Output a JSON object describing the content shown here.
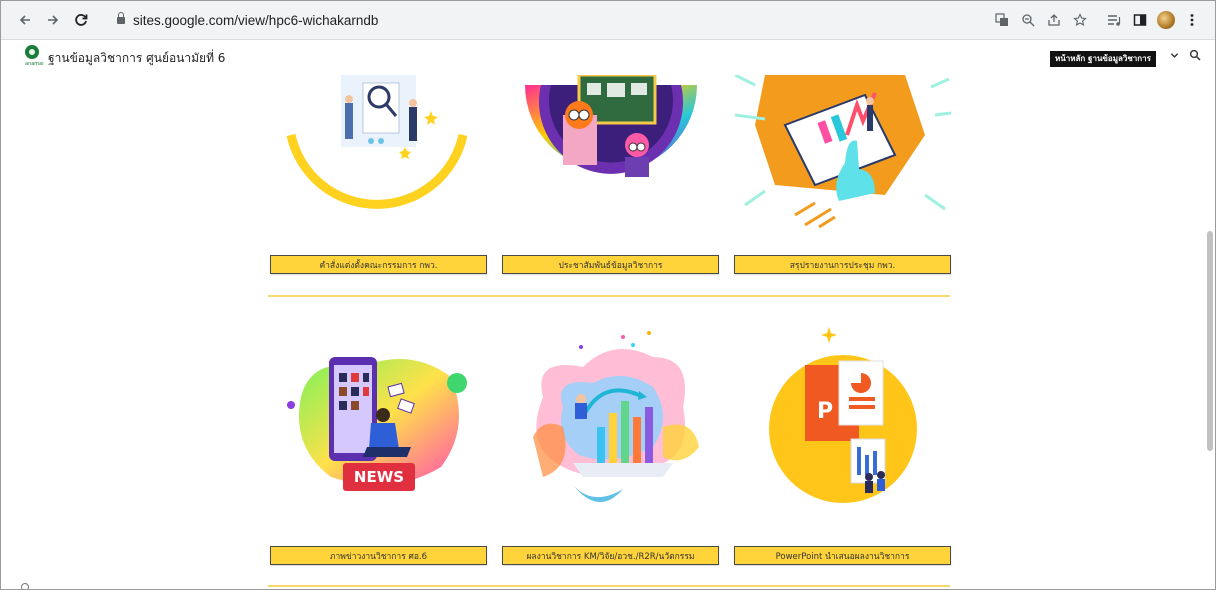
{
  "browser": {
    "url": "sites.google.com/view/hpc6-wichakarndb",
    "back_icon": "arrow-left-icon",
    "forward_icon": "arrow-right-icon",
    "reload_icon": "reload-icon"
  },
  "site": {
    "title": "ฐานข้อมูลวิชาการ ศูนย์อนามัยที่ 6",
    "logo_caption": "anamai",
    "nav_current": "หน้าหลัก ฐานข้อมูลวิชาการ"
  },
  "cards": [
    {
      "label": "คำสั่งแต่งตั้งคณะกรรมการ กพว.",
      "image": "team-analysis-illustration"
    },
    {
      "label": "ประชาสัมพันธ์ข้อมูลวิชาการ",
      "image": "classroom-circle-illustration"
    },
    {
      "label": "สรุปรายงานการประชุม กพว.",
      "image": "laptop-report-illustration"
    },
    {
      "label": "ภาพข่าวงานวิชาการ ศอ.6",
      "image": "news-phone-illustration"
    },
    {
      "label": "ผลงานวิชาการ KM/วิจัย/อวช./R2R/นวัตกรรม",
      "image": "bar-chart-splash-illustration"
    },
    {
      "label": "PowerPoint นำเสนอผลงานวิชาการ",
      "image": "powerpoint-illustration"
    }
  ],
  "news_badge": "NEWS",
  "colors": {
    "button_fill": "#ffd43b",
    "divider": "#f6d76a",
    "chrome": "#f1f3f4"
  }
}
